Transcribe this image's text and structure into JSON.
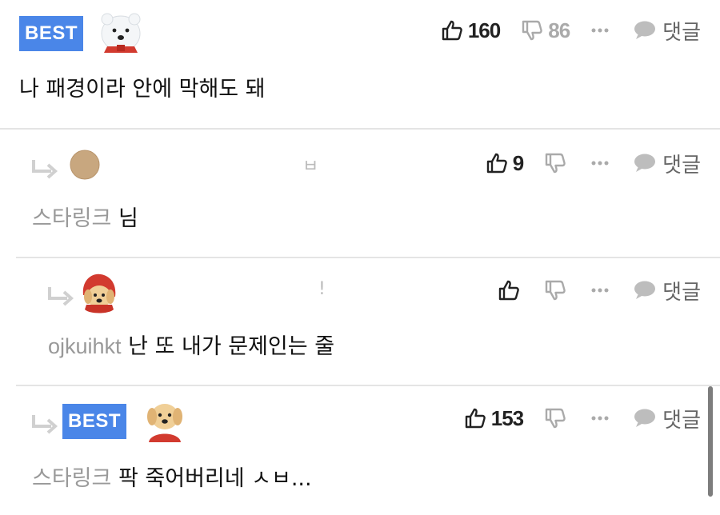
{
  "comments": [
    {
      "badge": "BEST",
      "avatar_icon": "polar-bear-icon",
      "likes": "160",
      "dislikes": "86",
      "reply_label": "댓글",
      "text": "나 패경이라 안에 막해도 돼"
    },
    {
      "avatar_icon": "plain-avatar-icon",
      "blurred_name": "ㅂ",
      "likes": "9",
      "reply_label": "댓글",
      "author": "스타링크",
      "text": "님"
    },
    {
      "avatar_icon": "puppy-red-hood-icon",
      "blurred_name": "!",
      "reply_label": "댓글",
      "author": "ojkuihkt",
      "text": "난 또 내가 문제인는 줄"
    },
    {
      "badge": "BEST",
      "avatar_icon": "puppy-red-hood-icon",
      "likes": "153",
      "reply_label": "댓글",
      "author": "스타링크",
      "text": "팍 죽어버리네 ㅅㅂ..."
    }
  ],
  "colors": {
    "best_badge": "#4a86e8",
    "divider": "#e4e4e4",
    "author": "#999999"
  }
}
